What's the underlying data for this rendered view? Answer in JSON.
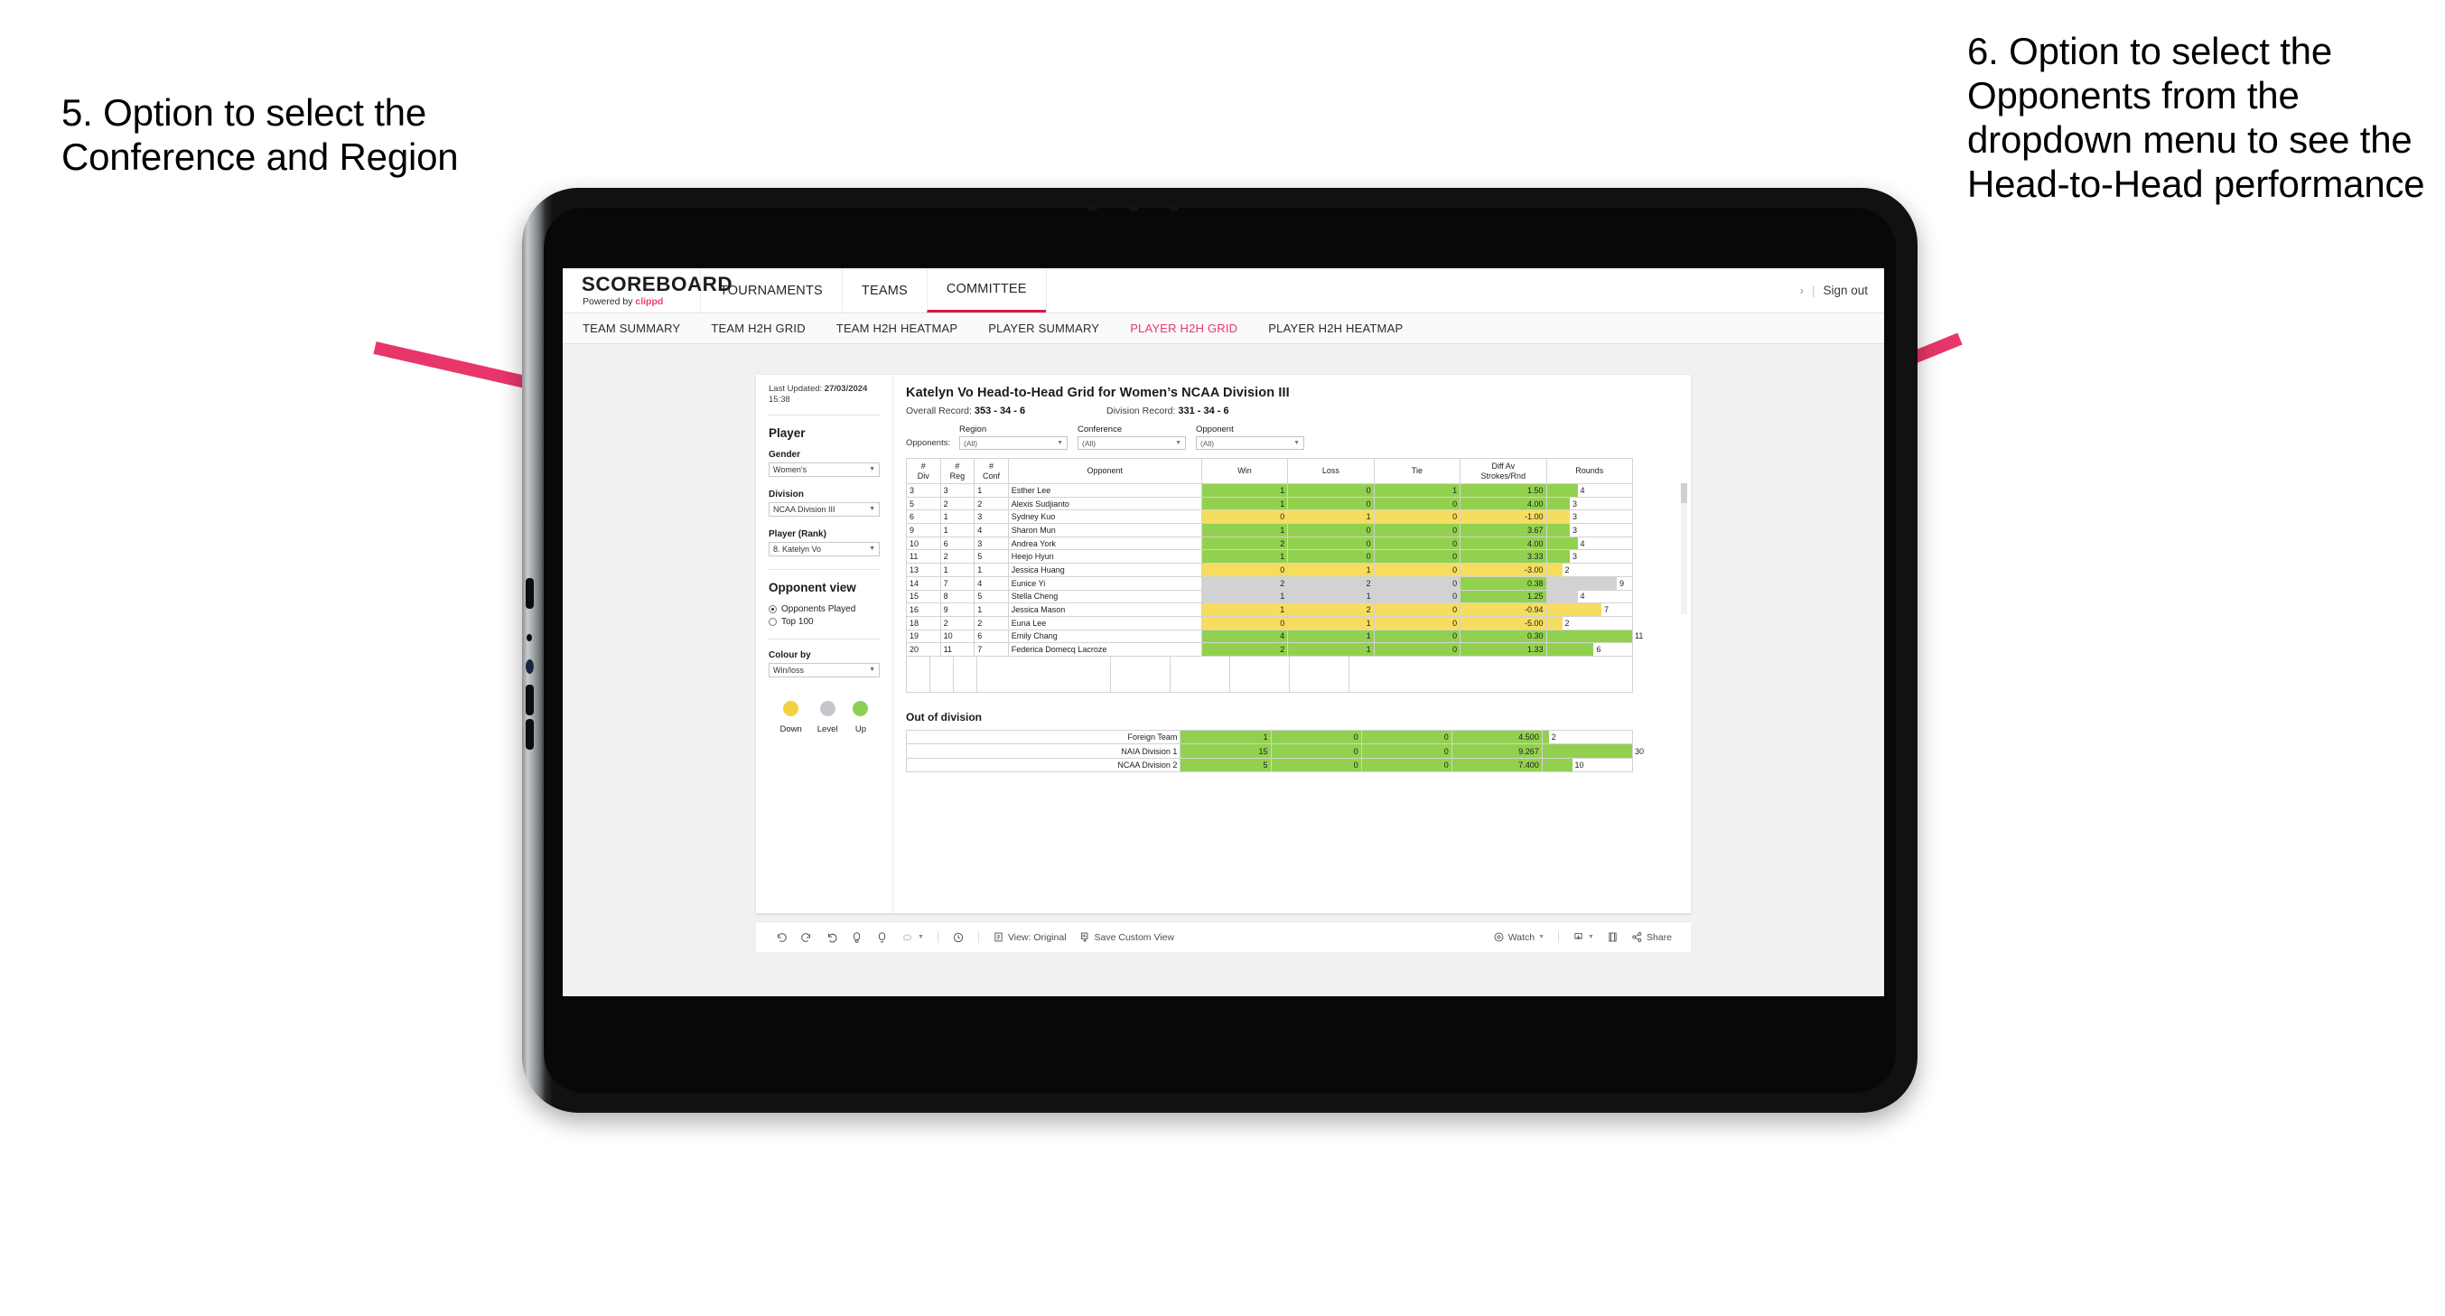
{
  "annotations": {
    "left": "5. Option to select the Conference and Region",
    "right": "6. Option to select the Opponents from the dropdown menu to see the Head-to-Head performance",
    "arrow_color": "#e8366a"
  },
  "app": {
    "brand": {
      "wordmark": "SCOREBOARD",
      "powered_prefix": "Powered by",
      "powered_brand": "clippd"
    },
    "header_tabs": [
      {
        "label": "TOURNAMENTS",
        "active": false
      },
      {
        "label": "TEAMS",
        "active": false
      },
      {
        "label": "COMMITTEE",
        "active": true
      }
    ],
    "header_right": {
      "chevron": "›",
      "divider": "|",
      "signout": "Sign out"
    },
    "subnav": [
      {
        "label": "TEAM SUMMARY",
        "active": false
      },
      {
        "label": "TEAM H2H GRID",
        "active": false
      },
      {
        "label": "TEAM H2H HEATMAP",
        "active": false
      },
      {
        "label": "PLAYER SUMMARY",
        "active": false
      },
      {
        "label": "PLAYER H2H GRID",
        "active": true
      },
      {
        "label": "PLAYER H2H HEATMAP",
        "active": false
      }
    ]
  },
  "sidebar": {
    "last_updated_label": "Last Updated:",
    "last_updated_value": "27/03/2024",
    "last_updated_time": "15:38",
    "player_heading": "Player",
    "fields": [
      {
        "label": "Gender",
        "value": "Women's"
      },
      {
        "label": "Division",
        "value": "NCAA Division III"
      },
      {
        "label": "Player (Rank)",
        "value": "8. Katelyn Vo"
      }
    ],
    "opponent_view_heading": "Opponent view",
    "opponent_view_options": [
      {
        "label": "Opponents Played",
        "selected": true
      },
      {
        "label": "Top 100",
        "selected": false
      }
    ],
    "colour_by_label": "Colour by",
    "colour_by_value": "Win/loss",
    "legend": [
      {
        "label": "Down",
        "color": "#f5d13f"
      },
      {
        "label": "Level",
        "color": "#c4c8cc"
      },
      {
        "label": "Up",
        "color": "#8fce55"
      }
    ]
  },
  "main": {
    "title": "Katelyn Vo Head-to-Head Grid for Women’s NCAA Division III",
    "overall_record_label": "Overall Record:",
    "overall_record_value": "353 - 34 - 6",
    "division_record_label": "Division Record:",
    "division_record_value": "331 - 34 - 6",
    "filters_prefix": "Opponents:",
    "filters": [
      {
        "label": "Region",
        "value": "(All)"
      },
      {
        "label": "Conference",
        "value": "(All)"
      },
      {
        "label": "Opponent",
        "value": "(All)"
      }
    ],
    "out_of_division_title": "Out of division"
  },
  "chart_data": {
    "type": "table",
    "title": "Katelyn Vo Head-to-Head Grid for Women’s NCAA Division III",
    "columns": [
      "# Div",
      "# Reg",
      "# Conf",
      "Opponent",
      "Win",
      "Loss",
      "Tie",
      "Diff Av Strokes/Rnd",
      "Rounds"
    ],
    "column_header_lines": [
      [
        "#",
        "Div"
      ],
      [
        "#",
        "Reg"
      ],
      [
        "#",
        "Conf"
      ],
      [
        "Opponent"
      ],
      [
        "Win"
      ],
      [
        "Loss"
      ],
      [
        "Tie"
      ],
      [
        "Diff Av",
        "Strokes/Rnd"
      ],
      [
        "Rounds"
      ]
    ],
    "rounds_max": 11,
    "rows": [
      {
        "div": "3",
        "reg": "3",
        "conf": "1",
        "opponent": "Esther Lee",
        "win": "1",
        "loss": "0",
        "tie": "1",
        "diff": "1.50",
        "rounds": "4",
        "color": "green"
      },
      {
        "div": "5",
        "reg": "2",
        "conf": "2",
        "opponent": "Alexis Sudjianto",
        "win": "1",
        "loss": "0",
        "tie": "0",
        "diff": "4.00",
        "rounds": "3",
        "color": "green"
      },
      {
        "div": "6",
        "reg": "1",
        "conf": "3",
        "opponent": "Sydney Kuo",
        "win": "0",
        "loss": "1",
        "tie": "0",
        "diff": "-1.00",
        "rounds": "3",
        "color": "yellow"
      },
      {
        "div": "9",
        "reg": "1",
        "conf": "4",
        "opponent": "Sharon Mun",
        "win": "1",
        "loss": "0",
        "tie": "0",
        "diff": "3.67",
        "rounds": "3",
        "color": "green"
      },
      {
        "div": "10",
        "reg": "6",
        "conf": "3",
        "opponent": "Andrea York",
        "win": "2",
        "loss": "0",
        "tie": "0",
        "diff": "4.00",
        "rounds": "4",
        "color": "green"
      },
      {
        "div": "11",
        "reg": "2",
        "conf": "5",
        "opponent": "Heejo Hyun",
        "win": "1",
        "loss": "0",
        "tie": "0",
        "diff": "3.33",
        "rounds": "3",
        "color": "green"
      },
      {
        "div": "13",
        "reg": "1",
        "conf": "1",
        "opponent": "Jessica Huang",
        "win": "0",
        "loss": "1",
        "tie": "0",
        "diff": "-3.00",
        "rounds": "2",
        "color": "yellow"
      },
      {
        "div": "14",
        "reg": "7",
        "conf": "4",
        "opponent": "Eunice Yi",
        "win": "2",
        "loss": "2",
        "tie": "0",
        "diff": "0.38",
        "rounds": "9",
        "color": "neutral",
        "diff_color": "green"
      },
      {
        "div": "15",
        "reg": "8",
        "conf": "5",
        "opponent": "Stella Cheng",
        "win": "1",
        "loss": "1",
        "tie": "0",
        "diff": "1.25",
        "rounds": "4",
        "color": "neutral",
        "diff_color": "green"
      },
      {
        "div": "16",
        "reg": "9",
        "conf": "1",
        "opponent": "Jessica Mason",
        "win": "1",
        "loss": "2",
        "tie": "0",
        "diff": "-0.94",
        "rounds": "7",
        "color": "yellow"
      },
      {
        "div": "18",
        "reg": "2",
        "conf": "2",
        "opponent": "Euna Lee",
        "win": "0",
        "loss": "1",
        "tie": "0",
        "diff": "-5.00",
        "rounds": "2",
        "color": "yellow"
      },
      {
        "div": "19",
        "reg": "10",
        "conf": "6",
        "opponent": "Emily Chang",
        "win": "4",
        "loss": "1",
        "tie": "0",
        "diff": "0.30",
        "rounds": "11",
        "color": "green"
      },
      {
        "div": "20",
        "reg": "11",
        "conf": "7",
        "opponent": "Federica Domecq Lacroze",
        "win": "2",
        "loss": "1",
        "tie": "0",
        "diff": "1.33",
        "rounds": "6",
        "color": "green"
      }
    ],
    "out_of_division": {
      "rounds_max": 30,
      "rows": [
        {
          "label": "Foreign Team",
          "win": "1",
          "loss": "0",
          "tie": "0",
          "diff": "4.500",
          "rounds": "2",
          "color": "green"
        },
        {
          "label": "NAIA Division 1",
          "win": "15",
          "loss": "0",
          "tie": "0",
          "diff": "9.267",
          "rounds": "30",
          "color": "green"
        },
        {
          "label": "NCAA Division 2",
          "win": "5",
          "loss": "0",
          "tie": "0",
          "diff": "7.400",
          "rounds": "10",
          "color": "green"
        }
      ]
    }
  },
  "toolbar": {
    "items": [
      {
        "name": "undo",
        "label": ""
      },
      {
        "name": "redo",
        "label": ""
      },
      {
        "name": "revert",
        "label": ""
      },
      {
        "name": "refresh",
        "label": ""
      },
      {
        "name": "pause",
        "label": ""
      },
      {
        "name": "alerts",
        "label": ""
      }
    ],
    "view_label": "View: Original",
    "save_label": "Save Custom View",
    "watch_label": "Watch",
    "share_label": "Share"
  },
  "colors": {
    "accent": "#e8366a",
    "active_tab": "#d5194a",
    "green": "#92d14f",
    "yellow": "#f6dd60",
    "neutral": "#d2d2d2"
  }
}
